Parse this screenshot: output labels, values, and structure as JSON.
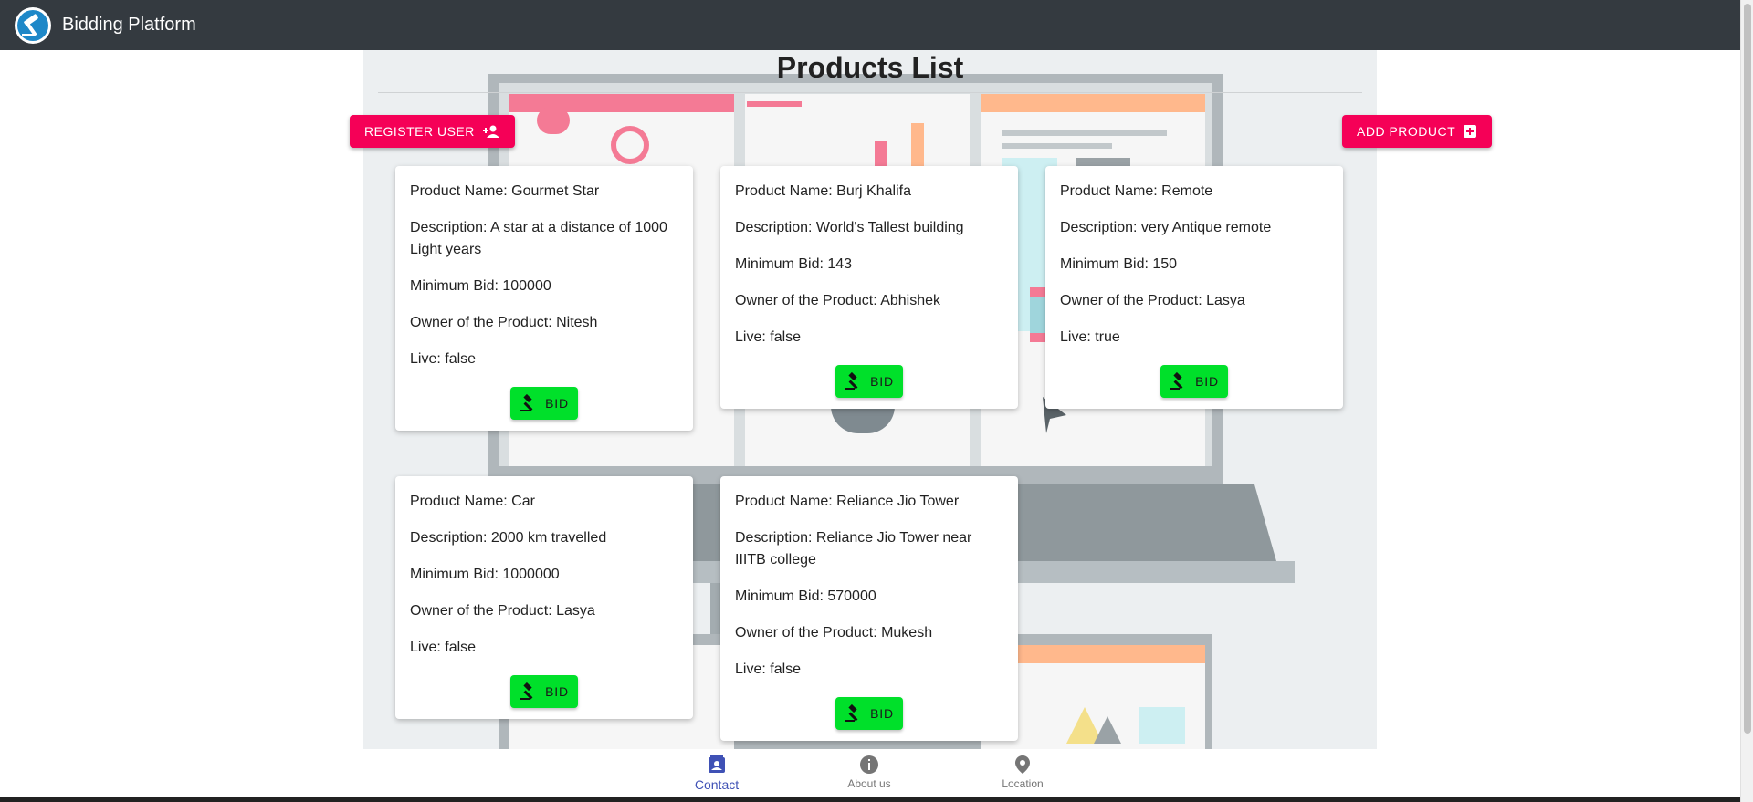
{
  "app": {
    "title": "Bidding Platform"
  },
  "page": {
    "title": "Products List"
  },
  "actions": {
    "register_label": "REGISTER USER",
    "add_product_label": "ADD PRODUCT"
  },
  "products": [
    {
      "name": "Product Name: Gourmet Star",
      "description": "Description: A star at a distance of 1000 Light years",
      "min_bid": "Minimum Bid: 100000",
      "owner": "Owner of the Product: Nitesh",
      "live": "Live: false",
      "bid_label": "BID"
    },
    {
      "name": "Product Name: Burj Khalifa",
      "description": "Description: World's Tallest building",
      "min_bid": "Minimum Bid: 143",
      "owner": "Owner of the Product: Abhishek",
      "live": "Live: false",
      "bid_label": "BID"
    },
    {
      "name": "Product Name: Remote",
      "description": "Description: very Antique remote",
      "min_bid": "Minimum Bid: 150",
      "owner": "Owner of the Product: Lasya",
      "live": "Live: true",
      "bid_label": "BID"
    },
    {
      "name": "Product Name: Car",
      "description": "Description: 2000 km travelled",
      "min_bid": "Minimum Bid: 1000000",
      "owner": "Owner of the Product: Lasya",
      "live": "Live: false",
      "bid_label": "BID"
    },
    {
      "name": "Product Name: Reliance Jio Tower",
      "description": "Description: Reliance Jio Tower near IIITB college",
      "min_bid": "Minimum Bid: 570000",
      "owner": "Owner of the Product: Mukesh",
      "live": "Live: false",
      "bid_label": "BID"
    }
  ],
  "bottom_nav": {
    "items": [
      {
        "label": "Contact",
        "icon": "contact-icon",
        "active": true
      },
      {
        "label": "About us",
        "icon": "info-icon",
        "active": false
      },
      {
        "label": "Location",
        "icon": "location-pin-icon",
        "active": false
      }
    ]
  },
  "colors": {
    "appbar": "#343a40",
    "accent_pink": "#f50057",
    "bid_green": "#00e02a",
    "nav_active": "#3f51b5"
  }
}
